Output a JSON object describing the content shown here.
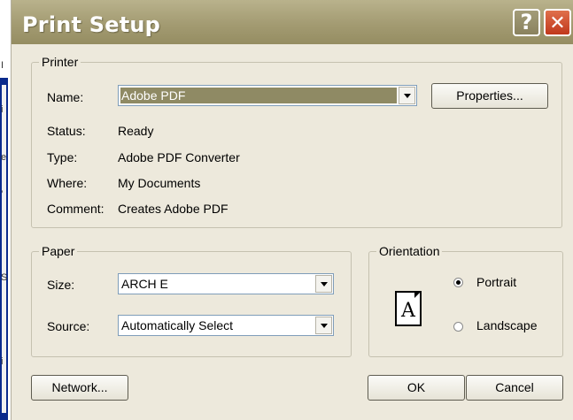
{
  "dialog": {
    "title": "Print Setup",
    "help_glyph": "?",
    "close_glyph": "✕"
  },
  "printer": {
    "group_label": "Printer",
    "name_label": "Name:",
    "name_value": "Adobe PDF",
    "properties_label": "Properties...",
    "status_label": "Status:",
    "status_value": "Ready",
    "type_label": "Type:",
    "type_value": "Adobe PDF Converter",
    "where_label": "Where:",
    "where_value": "My Documents",
    "comment_label": "Comment:",
    "comment_value": "Creates Adobe PDF"
  },
  "paper": {
    "group_label": "Paper",
    "size_label": "Size:",
    "size_value": "ARCH E",
    "source_label": "Source:",
    "source_value": "Automatically Select"
  },
  "orientation": {
    "group_label": "Orientation",
    "page_glyph": "A",
    "portrait_label": "Portrait",
    "landscape_label": "Landscape",
    "selected": "Portrait"
  },
  "footer": {
    "network_label": "Network...",
    "ok_label": "OK",
    "cancel_label": "Cancel"
  },
  "background": {
    "glyphs": [
      "I",
      "i",
      "e",
      "’",
      "S",
      "i"
    ]
  },
  "colors": {
    "titlebar": "#a39b72",
    "dialog_bg": "#ede9dc",
    "selection": "#8f8a64",
    "close_button": "#c9431f"
  }
}
